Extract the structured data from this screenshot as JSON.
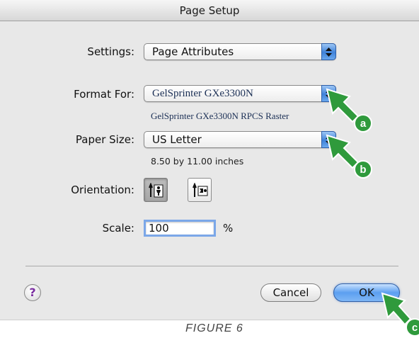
{
  "window": {
    "title": "Page Setup"
  },
  "settings": {
    "label": "Settings:",
    "value": "Page Attributes"
  },
  "format_for": {
    "label": "Format For:",
    "value": "GelSprinter GXe3300N",
    "subtitle": "GelSprinter GXe3300N RPCS Raster"
  },
  "paper_size": {
    "label": "Paper Size:",
    "value": "US Letter",
    "subtitle": "8.50 by 11.00 inches"
  },
  "orientation": {
    "label": "Orientation:",
    "options": [
      "portrait",
      "landscape"
    ],
    "selected": "portrait"
  },
  "scale": {
    "label": "Scale:",
    "value": "100",
    "unit": "%"
  },
  "footer": {
    "help_label": "?",
    "cancel_label": "Cancel",
    "ok_label": "OK"
  },
  "callouts": {
    "a": "a",
    "b": "b",
    "c": "c",
    "color": "#2f9a3c"
  },
  "caption": "FIGURE 6",
  "colors": {
    "stepper": "#3f82d9",
    "ok_button": "#5c9ff0",
    "focus_ring": "#7ba7e8"
  }
}
